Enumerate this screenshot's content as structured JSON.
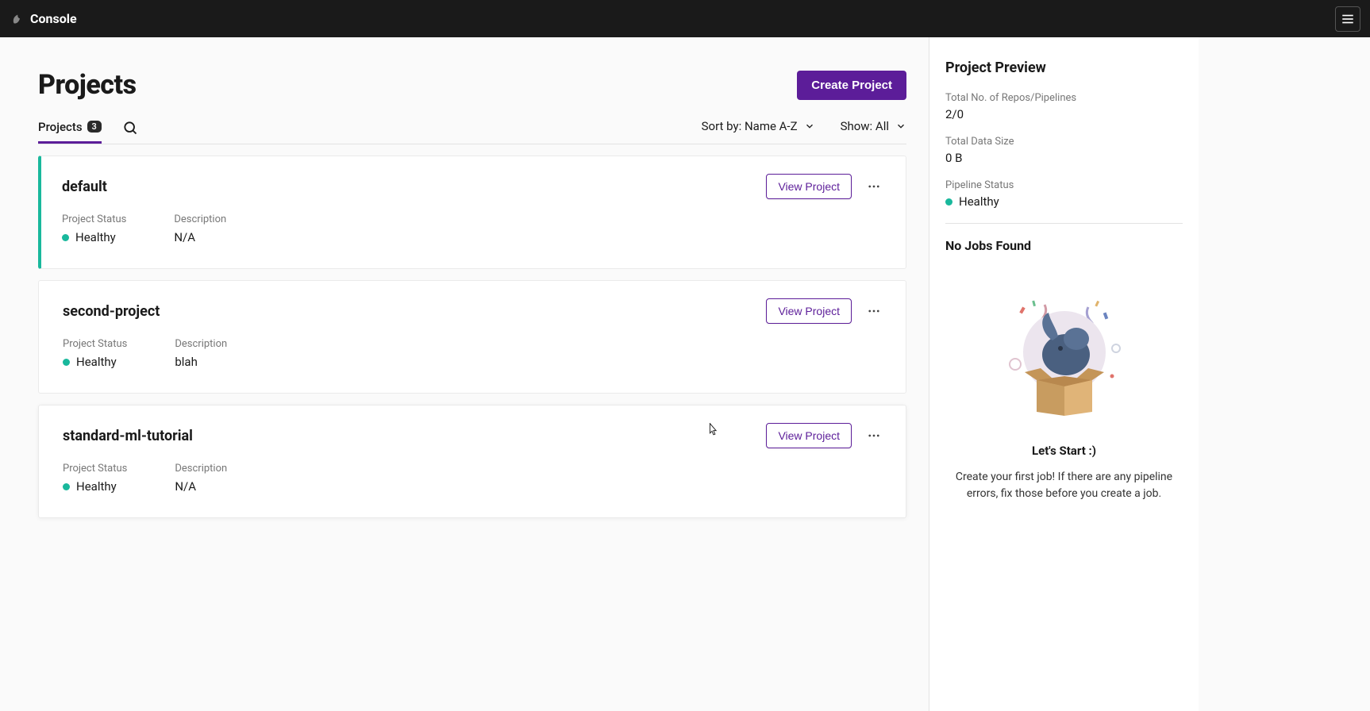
{
  "header": {
    "brand": "Console"
  },
  "page": {
    "title": "Projects",
    "create_button": "Create Project"
  },
  "tabs": {
    "projects_label": "Projects",
    "projects_count": "3"
  },
  "controls": {
    "sort_label": "Sort by: Name A-Z",
    "show_label": "Show: All"
  },
  "projects": [
    {
      "name": "default",
      "status_label": "Project Status",
      "status_value": "Healthy",
      "description_label": "Description",
      "description_value": "N/A",
      "view_label": "View  Project",
      "selected": true
    },
    {
      "name": "second-project",
      "status_label": "Project Status",
      "status_value": "Healthy",
      "description_label": "Description",
      "description_value": "blah",
      "view_label": "View  Project",
      "selected": false
    },
    {
      "name": "standard-ml-tutorial",
      "status_label": "Project Status",
      "status_value": "Healthy",
      "description_label": "Description",
      "description_value": "N/A",
      "view_label": "View  Project",
      "selected": false
    }
  ],
  "preview": {
    "title": "Project Preview",
    "repos_label": "Total No. of Repos/Pipelines",
    "repos_value": "2/0",
    "data_size_label": "Total Data Size",
    "data_size_value": "0 B",
    "pipeline_status_label": "Pipeline Status",
    "pipeline_status_value": "Healthy",
    "no_jobs": "No Jobs Found",
    "empty_title": "Let's Start :)",
    "empty_text": "Create your first job! If there are any pipeline errors, fix those before you create a job."
  }
}
